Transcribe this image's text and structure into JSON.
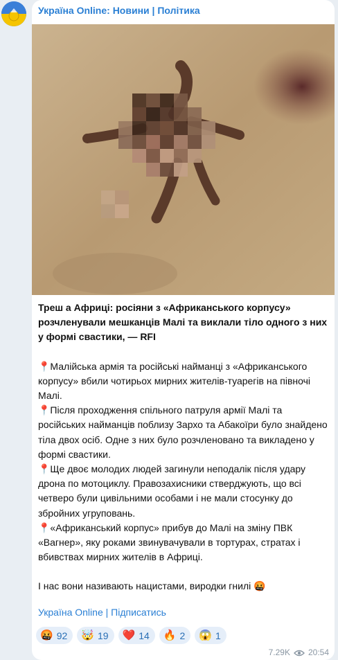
{
  "channel": {
    "title": "Україна Online: Новини | Політика",
    "subscribe_link": "Україна Online | Підписатись"
  },
  "post": {
    "headline": "Треш а Африці: росіяни з «Африканського корпусу» розчленували мешканців Малі та виклали тіло одного з них у формі свастики, — RFI",
    "paragraphs": [
      "📍Малійська армія та російські найманці з «Африканського корпусу» вбили чотирьох мирних жителів-туарегів на півночі Малі.",
      "📍Після проходження спільного патруля армії Малі та російських найманців поблизу Зархо та Абакоїри було знайдено тіла двох осіб. Одне з них було розчленовано та викладено у формі свастики.",
      "📍Ще двоє молодих людей загинули неподалік після удару дрона по мотоциклу. Правозахисники стверджують, що всі четверо були цивільними особами і не мали стосунку до збройних угруповань.",
      "📍«Африканський корпус» прибув до Малі на зміну ПВК «Вагнер», яку роками звинувачували в тортурах, стратах і вбивствах мирних жителів в Африці."
    ],
    "closing": "І нас вони називають нацистами, виродки гнилі 🤬"
  },
  "reactions": [
    {
      "emoji": "🤬",
      "count": "92"
    },
    {
      "emoji": "🤯",
      "count": "19"
    },
    {
      "emoji": "❤️",
      "count": "14"
    },
    {
      "emoji": "🔥",
      "count": "2"
    },
    {
      "emoji": "😱",
      "count": "1"
    }
  ],
  "meta": {
    "views": "7.29K",
    "time": "20:54"
  },
  "colors": {
    "link": "#2a7fd4",
    "reaction_bg": "#e5eef9",
    "page_bg": "#e9eef3"
  }
}
